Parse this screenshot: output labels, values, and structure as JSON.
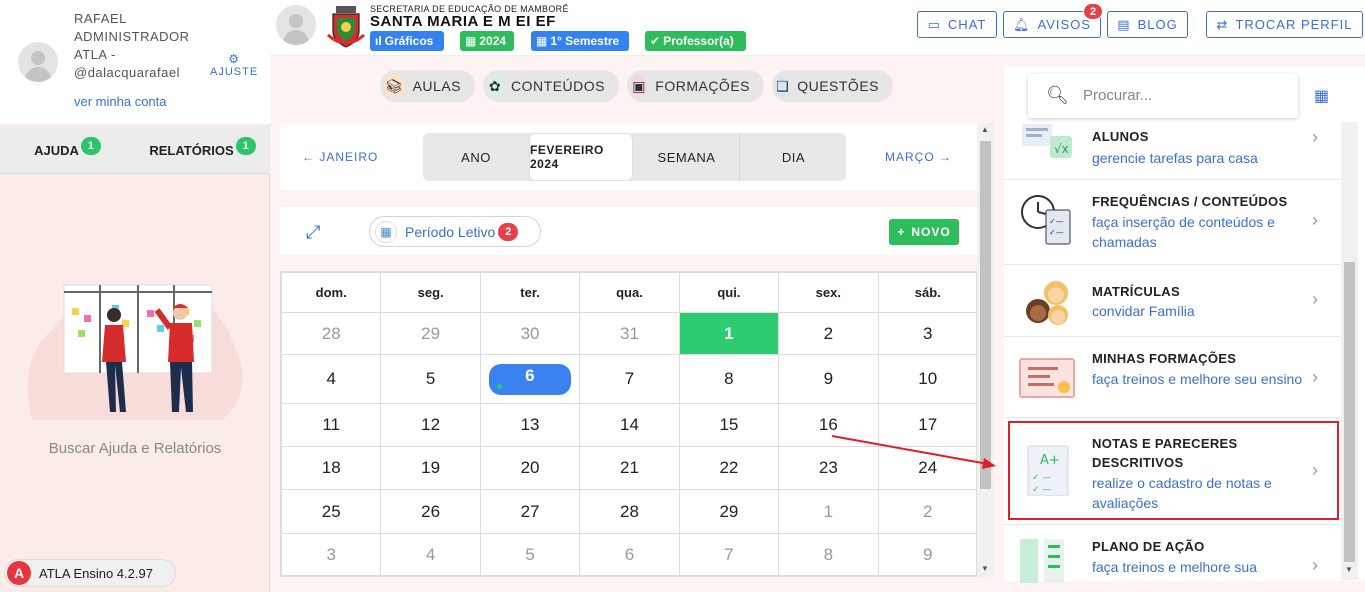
{
  "sidebar": {
    "user_name": "RAFAEL ADMINISTRADOR ATLA - @dalacquarafael",
    "account_link": "ver minha conta",
    "settings_label": "AJUSTE",
    "tabs": [
      {
        "label": "AJUDA",
        "badge": "1"
      },
      {
        "label": "RELATÓRIOS",
        "badge": "1"
      }
    ],
    "help_text": "Buscar Ajuda e Relatórios",
    "version": "ATLA Ensino 4.2.97",
    "version_logo": "A"
  },
  "header": {
    "secretaria": "SECRETARIA DE EDUCAÇÃO DE MAMBORÊ",
    "school": "SANTA MARIA E M EI EF",
    "pills": [
      "Gráficos",
      "2024",
      "1° Semestre",
      "Professor(a)"
    ],
    "buttons": {
      "chat": "CHAT",
      "avisos": "AVISOS",
      "avisos_badge": "2",
      "blog": "BLOG",
      "trocar": "TROCAR PERFIL"
    }
  },
  "top_tabs": [
    "AULAS",
    "CONTEÚDOS",
    "FORMAÇÕES",
    "QUESTÕES"
  ],
  "calendar": {
    "prev": "JANEIRO",
    "next": "MARÇO",
    "views": [
      "ANO",
      "FEVEREIRO 2024",
      "SEMANA",
      "DIA"
    ],
    "active_view": 1,
    "periodo_label": "Período Letivo",
    "periodo_badge": "2",
    "new_label": "NOVO",
    "weekdays": [
      "dom.",
      "seg.",
      "ter.",
      "qua.",
      "qui.",
      "sex.",
      "sáb."
    ],
    "weeks": [
      [
        "28",
        "29",
        "30",
        "31",
        "1",
        "2",
        "3"
      ],
      [
        "4",
        "5",
        "6",
        "7",
        "8",
        "9",
        "10"
      ],
      [
        "11",
        "12",
        "13",
        "14",
        "15",
        "16",
        "17"
      ],
      [
        "18",
        "19",
        "20",
        "21",
        "22",
        "23",
        "24"
      ],
      [
        "25",
        "26",
        "27",
        "28",
        "29",
        "1",
        "2"
      ],
      [
        "3",
        "4",
        "5",
        "6",
        "7",
        "8",
        "9"
      ]
    ],
    "today": "1",
    "selected": "6"
  },
  "right_panel": {
    "search_placeholder": "Procurar...",
    "items": [
      {
        "title": "ALUNOS",
        "subtitle": "gerencie tarefas para casa"
      },
      {
        "title": "FREQUÊNCIAS / CONTEÚDOS",
        "subtitle": "faça inserção de conteúdos e chamadas"
      },
      {
        "title": "MATRÍCULAS",
        "subtitle": "convidar Família"
      },
      {
        "title": "MINHAS FORMAÇÕES",
        "subtitle": "faça treinos e melhore seu ensino"
      },
      {
        "title": "NOTAS E PARECERES DESCRITIVOS",
        "subtitle": "realize o cadastro de notas e avaliações"
      },
      {
        "title": "PLANO DE AÇÃO",
        "subtitle": "faça treinos e melhore sua"
      }
    ],
    "highlight_color": "#e11d26"
  }
}
